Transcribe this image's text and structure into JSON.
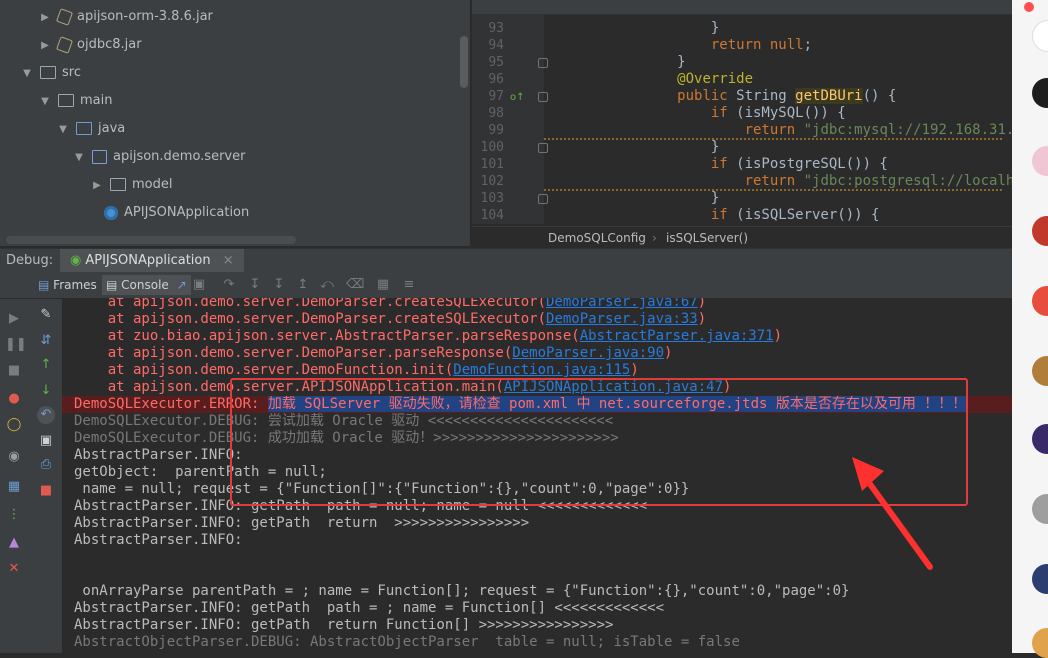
{
  "project_tree": {
    "items": [
      {
        "label": "apijson-orm-3.8.6.jar",
        "kind": "jar",
        "indent": 1,
        "expanded": false
      },
      {
        "label": "ojdbc8.jar",
        "kind": "jar",
        "indent": 1,
        "expanded": false
      },
      {
        "label": "src",
        "kind": "folder",
        "indent": 0,
        "expanded": true
      },
      {
        "label": "main",
        "kind": "folder",
        "indent": 1,
        "expanded": true
      },
      {
        "label": "java",
        "kind": "folder-blue",
        "indent": 2,
        "expanded": true
      },
      {
        "label": "apijson.demo.server",
        "kind": "package",
        "indent": 3,
        "expanded": true
      },
      {
        "label": "model",
        "kind": "folder",
        "indent": 4,
        "expanded": false
      },
      {
        "label": "APIJSONApplication",
        "kind": "app",
        "indent": 4,
        "expanded": null
      }
    ]
  },
  "editor": {
    "line_numbers": [
      "93",
      "94",
      "95",
      "96",
      "97",
      "98",
      "99",
      "100",
      "101",
      "102",
      "103",
      "104"
    ],
    "breadcrumb": [
      "DemoSQLConfig",
      "isSQLServer()"
    ]
  },
  "debug": {
    "label": "Debug:",
    "tab": "APIJSONApplication",
    "close": "×"
  },
  "toolbar": {
    "frames": "Frames",
    "console": "Console"
  },
  "console": {
    "error_prefix": "DemoSQLExecutor.ERROR: ",
    "error_message": "加载 SQLServer 驱动失败，请检查 pom.xml 中 net.sourceforge.jtds 版本是否存在以及可用 ！！！"
  },
  "colors": {
    "highlight_box": "#e23b3b",
    "error_bg": "#5a1d1d",
    "selection": "#214283"
  }
}
